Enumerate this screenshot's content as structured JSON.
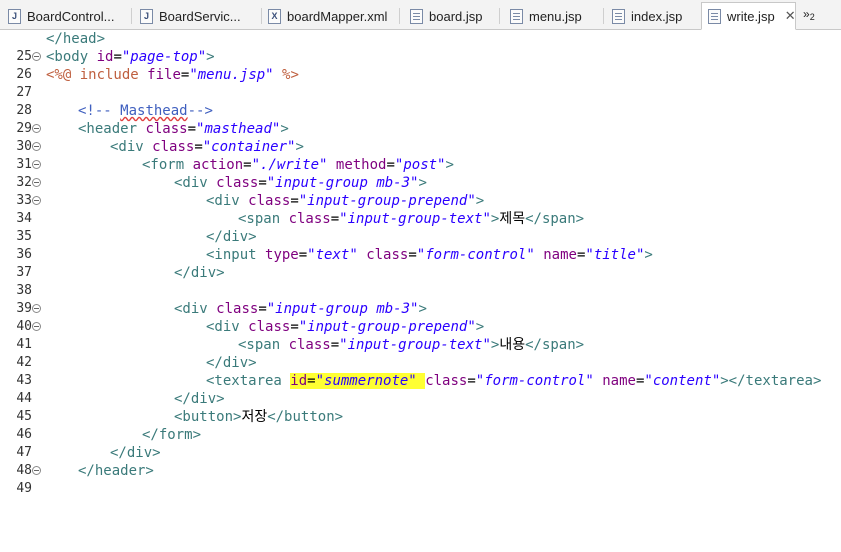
{
  "tabs": [
    {
      "label": "BoardControl...",
      "icon": "java-file-icon",
      "active": false
    },
    {
      "label": "BoardServic...",
      "icon": "java-file-icon",
      "active": false
    },
    {
      "label": "boardMapper.xml",
      "icon": "xml-file-icon",
      "active": false
    },
    {
      "label": "board.jsp",
      "icon": "jsp-file-icon",
      "active": false
    },
    {
      "label": "menu.jsp",
      "icon": "jsp-file-icon",
      "active": false
    },
    {
      "label": "index.jsp",
      "icon": "jsp-file-icon",
      "active": false
    },
    {
      "label": "write.jsp",
      "icon": "jsp-file-icon",
      "active": true
    }
  ],
  "overflow": {
    "label": "»",
    "count": "2"
  },
  "lines": [
    {
      "n": "25",
      "fold": false
    },
    {
      "n": "26",
      "fold": true
    },
    {
      "n": "27",
      "fold": false
    },
    {
      "n": "28",
      "fold": false
    },
    {
      "n": "29",
      "fold": false
    },
    {
      "n": "30",
      "fold": true
    },
    {
      "n": "31",
      "fold": true
    },
    {
      "n": "32",
      "fold": true
    },
    {
      "n": "33",
      "fold": true
    },
    {
      "n": "34",
      "fold": true
    },
    {
      "n": "35",
      "fold": false
    },
    {
      "n": "36",
      "fold": false
    },
    {
      "n": "37",
      "fold": false
    },
    {
      "n": "38",
      "fold": false
    },
    {
      "n": "39",
      "fold": false
    },
    {
      "n": "40",
      "fold": true
    },
    {
      "n": "41",
      "fold": true
    },
    {
      "n": "42",
      "fold": false
    },
    {
      "n": "43",
      "fold": false
    },
    {
      "n": "44",
      "fold": false
    },
    {
      "n": "45",
      "fold": false
    },
    {
      "n": "46",
      "fold": false
    },
    {
      "n": "47",
      "fold": false
    },
    {
      "n": "48",
      "fold": false
    },
    {
      "n": "49",
      "fold": true
    }
  ],
  "code": {
    "l25": {
      "a": "</head>"
    },
    "l26": {
      "a": "<body ",
      "b": "id",
      "c": "=",
      "d": "\"page-top\"",
      "e": ">"
    },
    "l27": {
      "a": "<%@ include ",
      "b": "file",
      "c": "=",
      "d": "\"menu.jsp\"",
      "e": " %>"
    },
    "l29": {
      "a": "<!-- ",
      "b": "Masthead",
      "c": "-->"
    },
    "l30": {
      "a": "<header ",
      "b": "class",
      "c": "=",
      "d": "\"masthead\"",
      "e": ">"
    },
    "l31": {
      "a": "<div ",
      "b": "class",
      "c": "=",
      "d": "\"container\"",
      "e": ">"
    },
    "l32": {
      "a": "<form ",
      "b": "action",
      "c": "=",
      "d": "\"./write\"",
      "e": " ",
      "f": "method",
      "g": "=",
      "h": "\"post\"",
      "i": ">"
    },
    "l33": {
      "a": "<div ",
      "b": "class",
      "c": "=",
      "d": "\"input-group mb-3\"",
      "e": ">"
    },
    "l34": {
      "a": "<div ",
      "b": "class",
      "c": "=",
      "d": "\"input-group-prepend\"",
      "e": ">"
    },
    "l35": {
      "a": "<span ",
      "b": "class",
      "c": "=",
      "d": "\"input-group-text\"",
      "e": ">",
      "f": "제목",
      "g": "</span>"
    },
    "l36": {
      "a": "</div>"
    },
    "l37": {
      "a": "<input ",
      "b": "type",
      "c": "=",
      "d": "\"text\"",
      "e": " ",
      "f": "class",
      "g": "=",
      "h": "\"form-control\"",
      "i": " ",
      "j": "name",
      "k": "=",
      "l": "\"title\"",
      "m": ">"
    },
    "l38": {
      "a": "</div>"
    },
    "l40": {
      "a": "<div ",
      "b": "class",
      "c": "=",
      "d": "\"input-group mb-3\"",
      "e": ">"
    },
    "l41": {
      "a": "<div ",
      "b": "class",
      "c": "=",
      "d": "\"input-group-prepend\"",
      "e": ">"
    },
    "l42": {
      "a": "<span ",
      "b": "class",
      "c": "=",
      "d": "\"input-group-text\"",
      "e": ">",
      "f": "내용",
      "g": "</span>"
    },
    "l43": {
      "a": "</div>"
    },
    "l44": {
      "a": "<textarea ",
      "b": "id",
      "c": "=",
      "d": "\"summernote\"",
      "e": " ",
      "f": "class",
      "g": "=",
      "h": "\"form-control\"",
      "i": " ",
      "j": "name",
      "k": "=",
      "l": "\"content\"",
      "m": "></textarea>"
    },
    "l45": {
      "a": "</div>"
    },
    "l46": {
      "a": "<button>",
      "b": "저장",
      "c": "</button>"
    },
    "l47": {
      "a": "</form>"
    },
    "l48": {
      "a": "</div>"
    },
    "l49": {
      "a": "</header>"
    }
  },
  "colors": {
    "tag": "#3f7f7f",
    "attribute": "#7f007f",
    "value": "#2a00ff",
    "comment": "#3f5fbf",
    "directive": "#bf5f3f",
    "highlight": "#ffff33"
  }
}
